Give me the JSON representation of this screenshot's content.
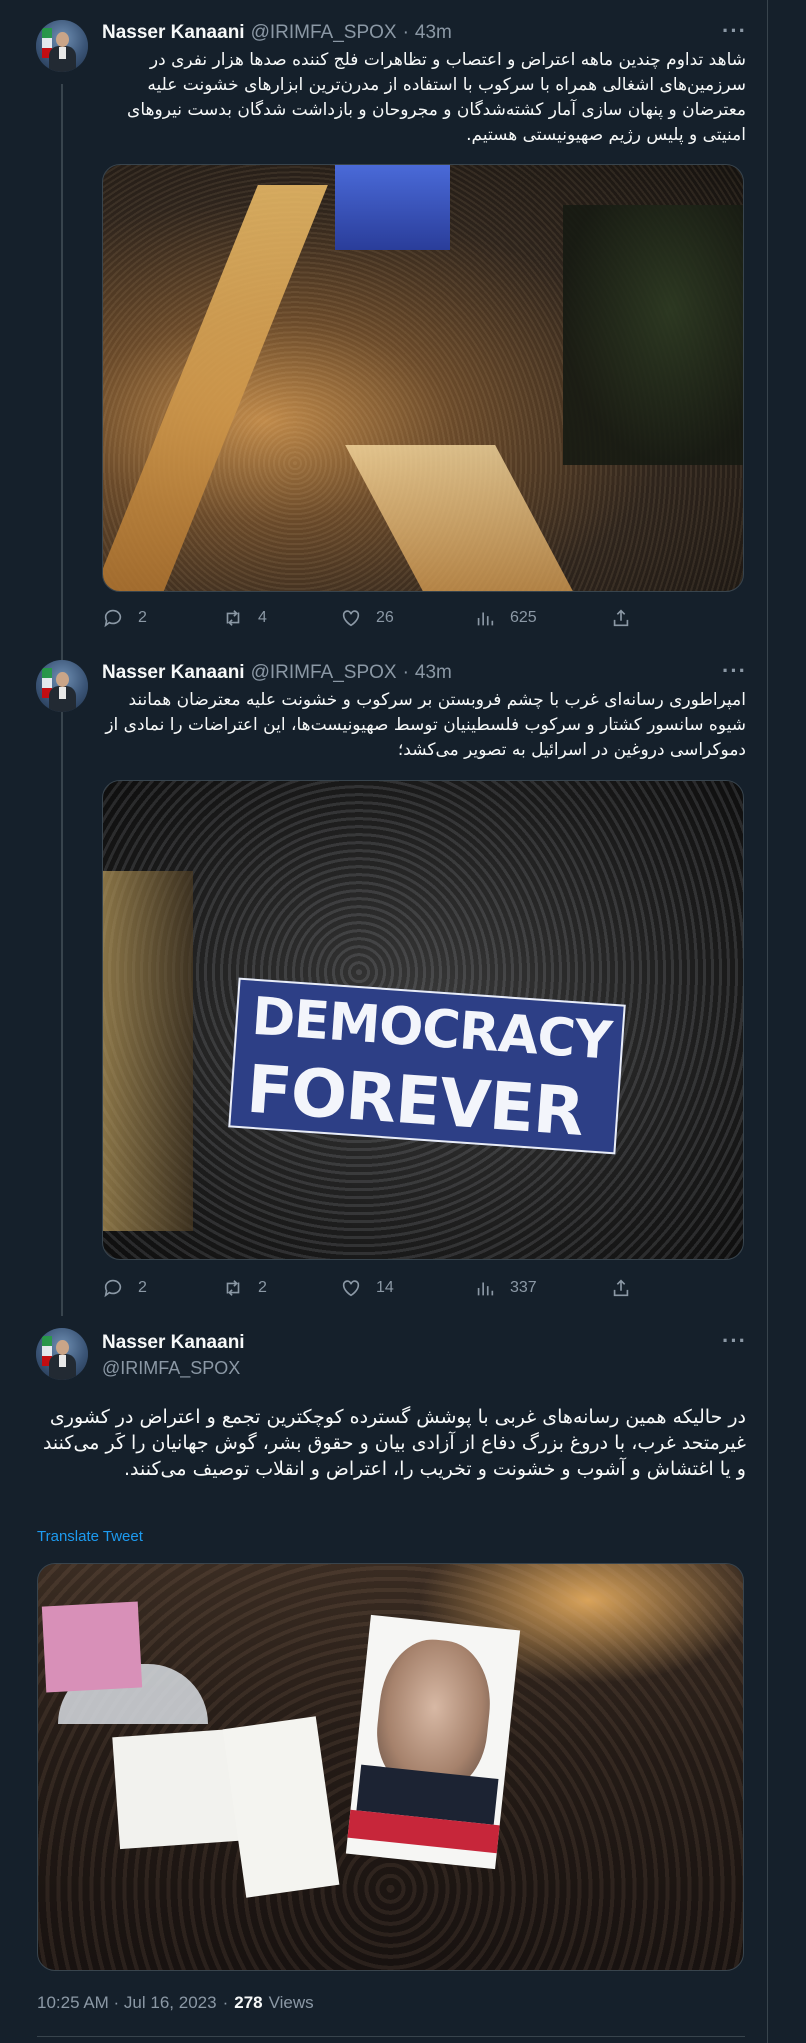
{
  "tweets": [
    {
      "name": "Nasser Kanaani",
      "handle": "@IRIMFA_SPOX",
      "sep": "·",
      "time": "43m",
      "text": "شاهد تداوم چندین ماهه اعتراض و اعتصاب و تظاهرات فلج کننده صدها هزار نفری در سرزمین‌های اشغالی همراه با سرکوب با استفاده از مدرن‌ترین ابزارهای خشونت علیه معترضان و پنهان سازی آمار کشته‌شدگان و مجروحان و بازداشت شدگان بدست نیروهای امنیتی و پلیس رژیم صهیونیستی هستیم.",
      "media_icon": "aerial-protest-photo",
      "replies": "2",
      "retweets": "4",
      "likes": "26",
      "views": "625"
    },
    {
      "name": "Nasser Kanaani",
      "handle": "@IRIMFA_SPOX",
      "sep": "·",
      "time": "43m",
      "text": "امپراطوری رسانه‌ای غرب با چشم فروبستن بر سرکوب و خشونت علیه معترضان همانند شیوه سانسور کشتار و سرکوب فلسطینیان توسط صهیونیست‌ها، این اعتراضات را نمادی از دموکراسی دروغین در اسرائیل به تصویر می‌کشد؛",
      "media_icon": "democracy-banner-photo",
      "banner_line1": "DEMOCRACY",
      "banner_line2": "FOREVER",
      "replies": "2",
      "retweets": "2",
      "likes": "14",
      "views": "337"
    },
    {
      "name": "Nasser Kanaani",
      "handle": "@IRIMFA_SPOX",
      "text": "در حالیکه همین رسانه‌های غربی با پوشش گسترده کوچکترین تجمع و اعتراض در کشوری غیرمتحد غرب، با دروغ بزرگ دفاع از آزادی بیان و حقوق بشر، گوش جهانیان را کَر می‌کنند و یا اغتشاش و آشوب و خشونت و تخریب را، اعتراض و انقلاب توصیف می‌کنند.",
      "translate": "Translate Tweet",
      "media_icon": "protest-signs-photo",
      "timestamp": "10:25 AM · Jul 16, 2023",
      "views_sep": "·",
      "views_count": "278",
      "views_label": "Views"
    }
  ],
  "colors": {
    "background": "#15202b",
    "border": "#38444d",
    "secondary_text": "#8b98a5",
    "link": "#1d9bf0"
  }
}
